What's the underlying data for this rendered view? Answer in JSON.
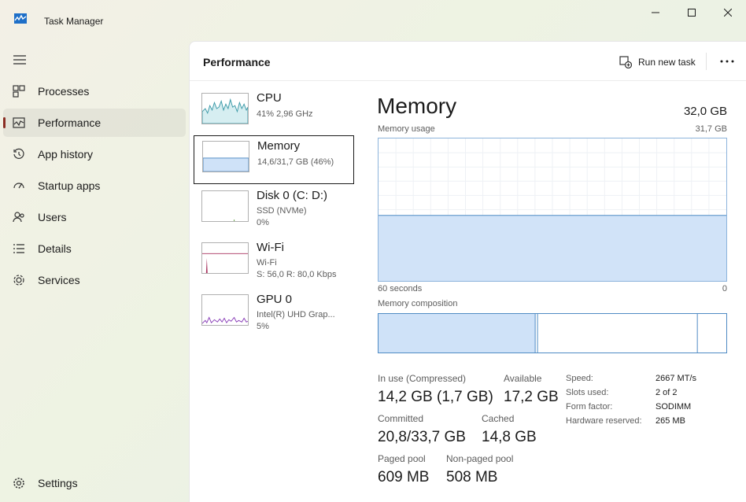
{
  "window": {
    "title": "Task Manager"
  },
  "sidebar": {
    "items": [
      {
        "label": "Processes",
        "icon": "processes-icon"
      },
      {
        "label": "Performance",
        "icon": "performance-icon"
      },
      {
        "label": "App history",
        "icon": "history-icon"
      },
      {
        "label": "Startup apps",
        "icon": "startup-icon"
      },
      {
        "label": "Users",
        "icon": "users-icon"
      },
      {
        "label": "Details",
        "icon": "details-icon"
      },
      {
        "label": "Services",
        "icon": "services-icon"
      }
    ],
    "settings_label": "Settings"
  },
  "header": {
    "title": "Performance",
    "run_task_label": "Run new task"
  },
  "devices": [
    {
      "name": "CPU",
      "sub1": "41%  2,96 GHz",
      "sub2": ""
    },
    {
      "name": "Memory",
      "sub1": "14,6/31,7 GB (46%)",
      "sub2": ""
    },
    {
      "name": "Disk 0 (C: D:)",
      "sub1": "SSD (NVMe)",
      "sub2": "0%"
    },
    {
      "name": "Wi-Fi",
      "sub1": "Wi-Fi",
      "sub2": "S: 56,0  R: 80,0 Kbps"
    },
    {
      "name": "GPU 0",
      "sub1": "Intel(R) UHD Grap...",
      "sub2": "5%"
    }
  ],
  "memory": {
    "title": "Memory",
    "total": "32,0 GB",
    "usage_label": "Memory usage",
    "usage_max": "31,7 GB",
    "time_left": "60 seconds",
    "time_right": "0",
    "composition_label": "Memory composition",
    "usage_fraction": 0.46,
    "stats": {
      "in_use_label": "In use (Compressed)",
      "in_use_value": "14,2 GB (1,7 GB)",
      "available_label": "Available",
      "available_value": "17,2 GB",
      "committed_label": "Committed",
      "committed_value": "20,8/33,7 GB",
      "cached_label": "Cached",
      "cached_value": "14,8 GB",
      "paged_label": "Paged pool",
      "paged_value": "609 MB",
      "nonpaged_label": "Non-paged pool",
      "nonpaged_value": "508 MB"
    },
    "details": {
      "speed_label": "Speed:",
      "speed_value": "2667 MT/s",
      "slots_label": "Slots used:",
      "slots_value": "2 of 2",
      "form_label": "Form factor:",
      "form_value": "SODIMM",
      "reserved_label": "Hardware reserved:",
      "reserved_value": "265 MB"
    }
  },
  "colors": {
    "accent": "#8b2d23",
    "memory_fill": "#cfe2f8",
    "memory_line": "#4f8bc4",
    "cpu_line": "#3d9aa8",
    "wifi_line": "#a8325e",
    "gpu_line": "#8a3fb8"
  }
}
